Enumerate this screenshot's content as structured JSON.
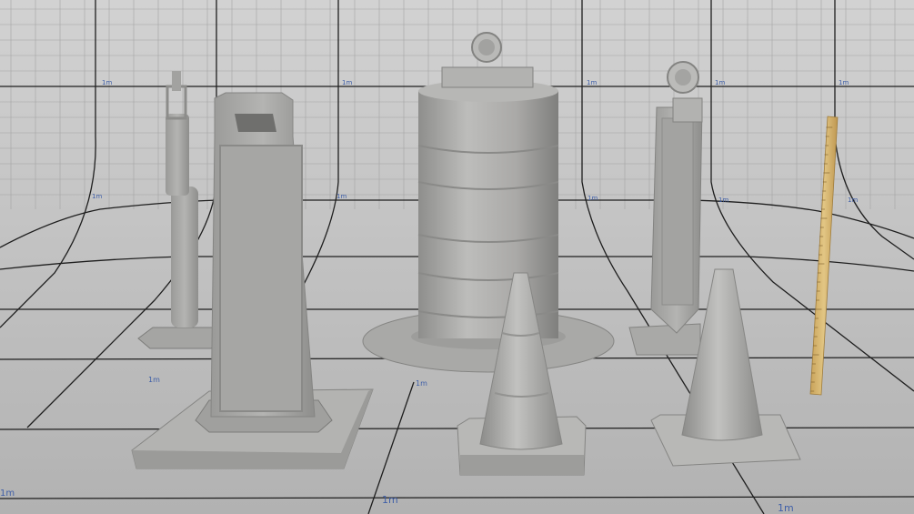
{
  "scene": {
    "grid_unit_label": "1m",
    "colors": {
      "backdrop": "#c9c9c9",
      "floor": "#bcbcbc",
      "grid_major": "#1b1b1b",
      "grid_minor": "#9a9a9a",
      "label_blue": "#3f5fa8",
      "object_gray": "#a7a7a5",
      "ruler_wood": "#d8b873"
    }
  },
  "objects": [
    {
      "name": "Channelizer delineator post"
    },
    {
      "name": "Vertical panel sign with weighted base"
    },
    {
      "name": "Traffic drum barrel with light"
    },
    {
      "name": "Traffic cone"
    },
    {
      "name": "Vertical panel with warning light"
    },
    {
      "name": "Traffic cone"
    },
    {
      "name": "Wooden measuring stick"
    }
  ]
}
